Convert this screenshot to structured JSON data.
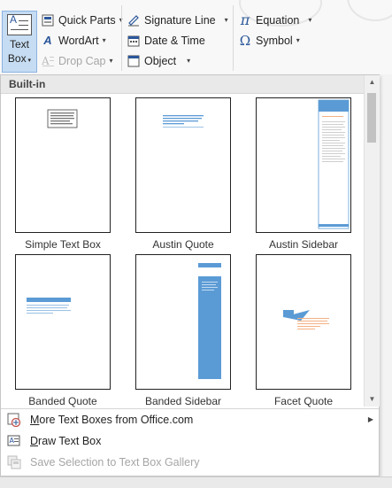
{
  "ribbon": {
    "text_box": {
      "line1": "Text",
      "line2": "Box"
    },
    "quick_parts": "Quick Parts",
    "wordart": "WordArt",
    "drop_cap": "Drop Cap",
    "signature_line": "Signature Line",
    "date_time": "Date & Time",
    "object": "Object",
    "equation": "Equation",
    "symbol": "Symbol",
    "equation_glyph": "π",
    "symbol_glyph": "Ω"
  },
  "gallery": {
    "header": "Built-in",
    "items": [
      {
        "label": "Simple Text Box"
      },
      {
        "label": "Austin Quote"
      },
      {
        "label": "Austin Sidebar"
      },
      {
        "label": "Banded Quote"
      },
      {
        "label": "Banded Sidebar"
      },
      {
        "label": "Facet Quote"
      }
    ]
  },
  "menu": {
    "more": "More Text Boxes from Office.com",
    "draw": "Draw Text Box",
    "save": "Save Selection to Text Box Gallery"
  },
  "colors": {
    "accent_blue": "#5b9bd5",
    "orange": "#ed7d31",
    "selected_bg": "#c5dcf2"
  }
}
